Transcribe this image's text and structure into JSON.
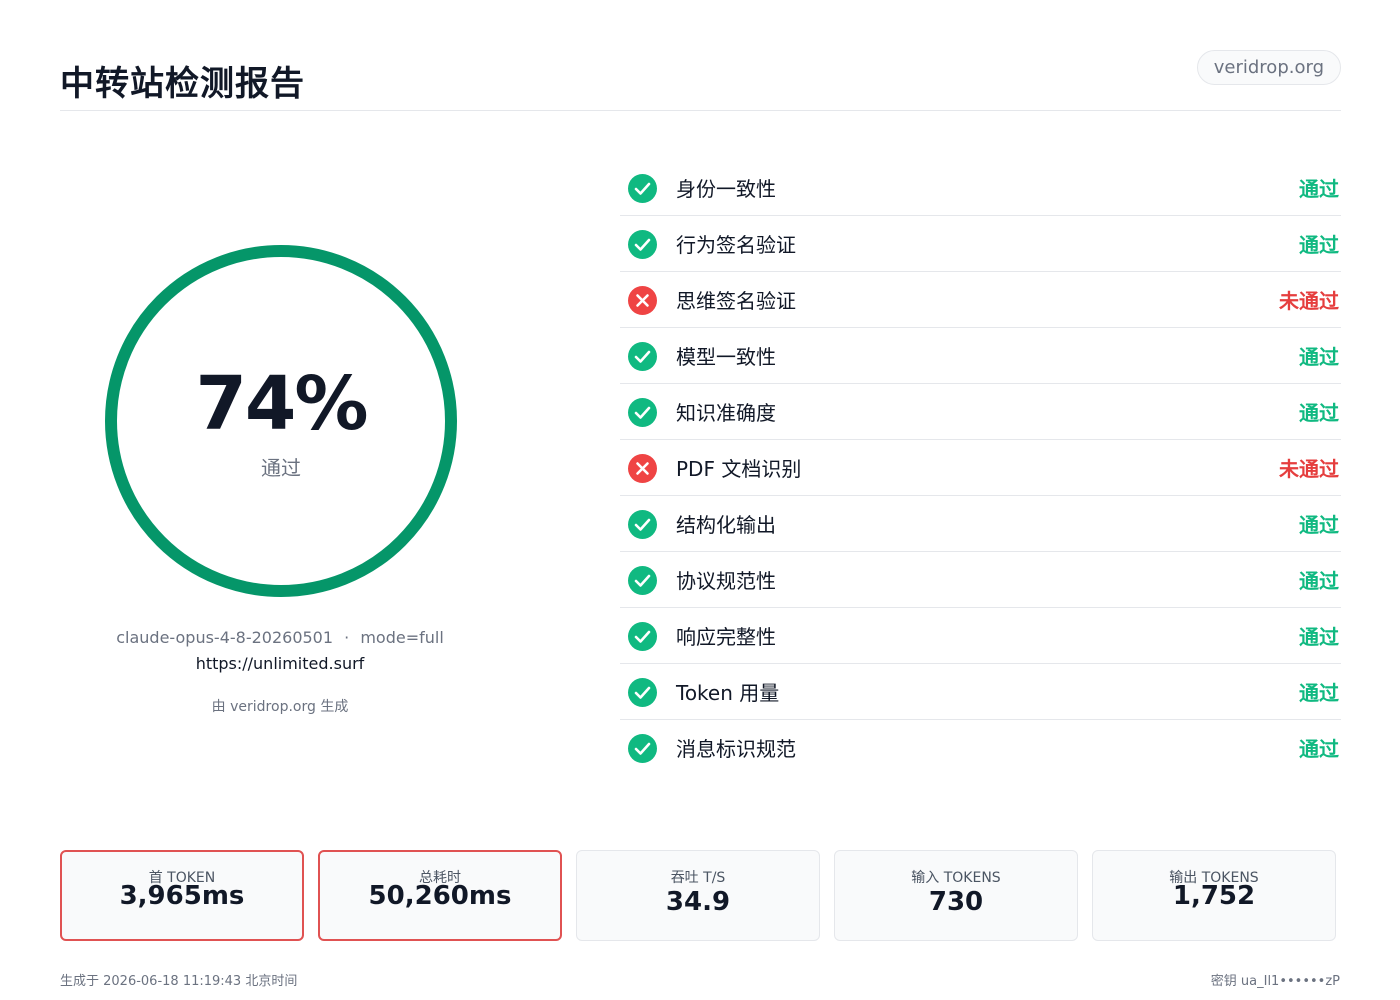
{
  "header": {
    "title": "中转站检测报告",
    "domain": "veridrop.org"
  },
  "score": {
    "percent": 74,
    "value_text": "74%",
    "label": "通过",
    "ring_color": "#059669"
  },
  "meta": {
    "model": "claude-opus-4-8-20260501",
    "separator": "·",
    "mode": "mode=full",
    "url": "https://unlimited.surf",
    "generated_by": "由 veridrop.org 生成"
  },
  "checks": [
    {
      "name": "身份一致性",
      "status": "通过",
      "pass": true,
      "icon": "check-icon"
    },
    {
      "name": "行为签名验证",
      "status": "通过",
      "pass": true,
      "icon": "check-icon"
    },
    {
      "name": "思维签名验证",
      "status": "未通过",
      "pass": false,
      "icon": "x-icon"
    },
    {
      "name": "模型一致性",
      "status": "通过",
      "pass": true,
      "icon": "check-icon"
    },
    {
      "name": "知识准确度",
      "status": "通过",
      "pass": true,
      "icon": "check-icon"
    },
    {
      "name": "PDF 文档识别",
      "status": "未通过",
      "pass": false,
      "icon": "x-icon"
    },
    {
      "name": "结构化输出",
      "status": "通过",
      "pass": true,
      "icon": "check-icon"
    },
    {
      "name": "协议规范性",
      "status": "通过",
      "pass": true,
      "icon": "check-icon"
    },
    {
      "name": "响应完整性",
      "status": "通过",
      "pass": true,
      "icon": "check-icon"
    },
    {
      "name": "Token 用量",
      "status": "通过",
      "pass": true,
      "icon": "check-icon"
    },
    {
      "name": "消息标识规范",
      "status": "通过",
      "pass": true,
      "icon": "check-icon"
    }
  ],
  "stats": [
    {
      "label": "首 TOKEN",
      "value": "3,965ms",
      "alert": true
    },
    {
      "label": "总耗时",
      "value": "50,260ms",
      "alert": true
    },
    {
      "label": "吞吐 T/S",
      "value": "34.9",
      "alert": false
    },
    {
      "label": "输入 TOKENS",
      "value": "730",
      "alert": false
    },
    {
      "label": "输出 TOKENS",
      "value": "1,752",
      "alert": false
    }
  ],
  "footer": {
    "generated_at": "生成于 2026-06-18 11:19:43 北京时间",
    "key": "密钥 ua_Il1••••••zP"
  },
  "colors": {
    "pass": "#10b981",
    "fail": "#ef4444",
    "alert_border": "#e05252"
  }
}
